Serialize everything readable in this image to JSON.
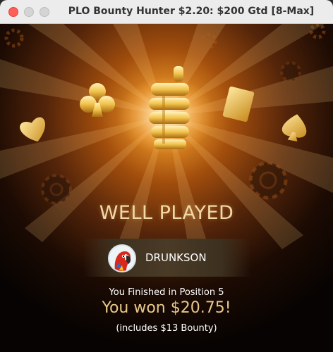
{
  "window": {
    "title": "PLO Bounty Hunter $2.20: $200 Gtd [8-Max]"
  },
  "result": {
    "heading": "WELL PLAYED",
    "player_name": "DRUNKSON",
    "finish_text": "You Finished in Position 5",
    "won_text": "You won $20.75!",
    "bounty_text": "(includes $13 Bounty)"
  },
  "colors": {
    "glow": "#e08a23",
    "gold": "#e8c88a",
    "heading": "#f1d9a6",
    "close_button": "#ff5f57"
  },
  "icons": [
    "club-icon",
    "heart-icon",
    "diamond-icon",
    "spade-icon",
    "thumbs-up-trophy-icon",
    "poker-chip-icon",
    "parrot-avatar-icon"
  ]
}
